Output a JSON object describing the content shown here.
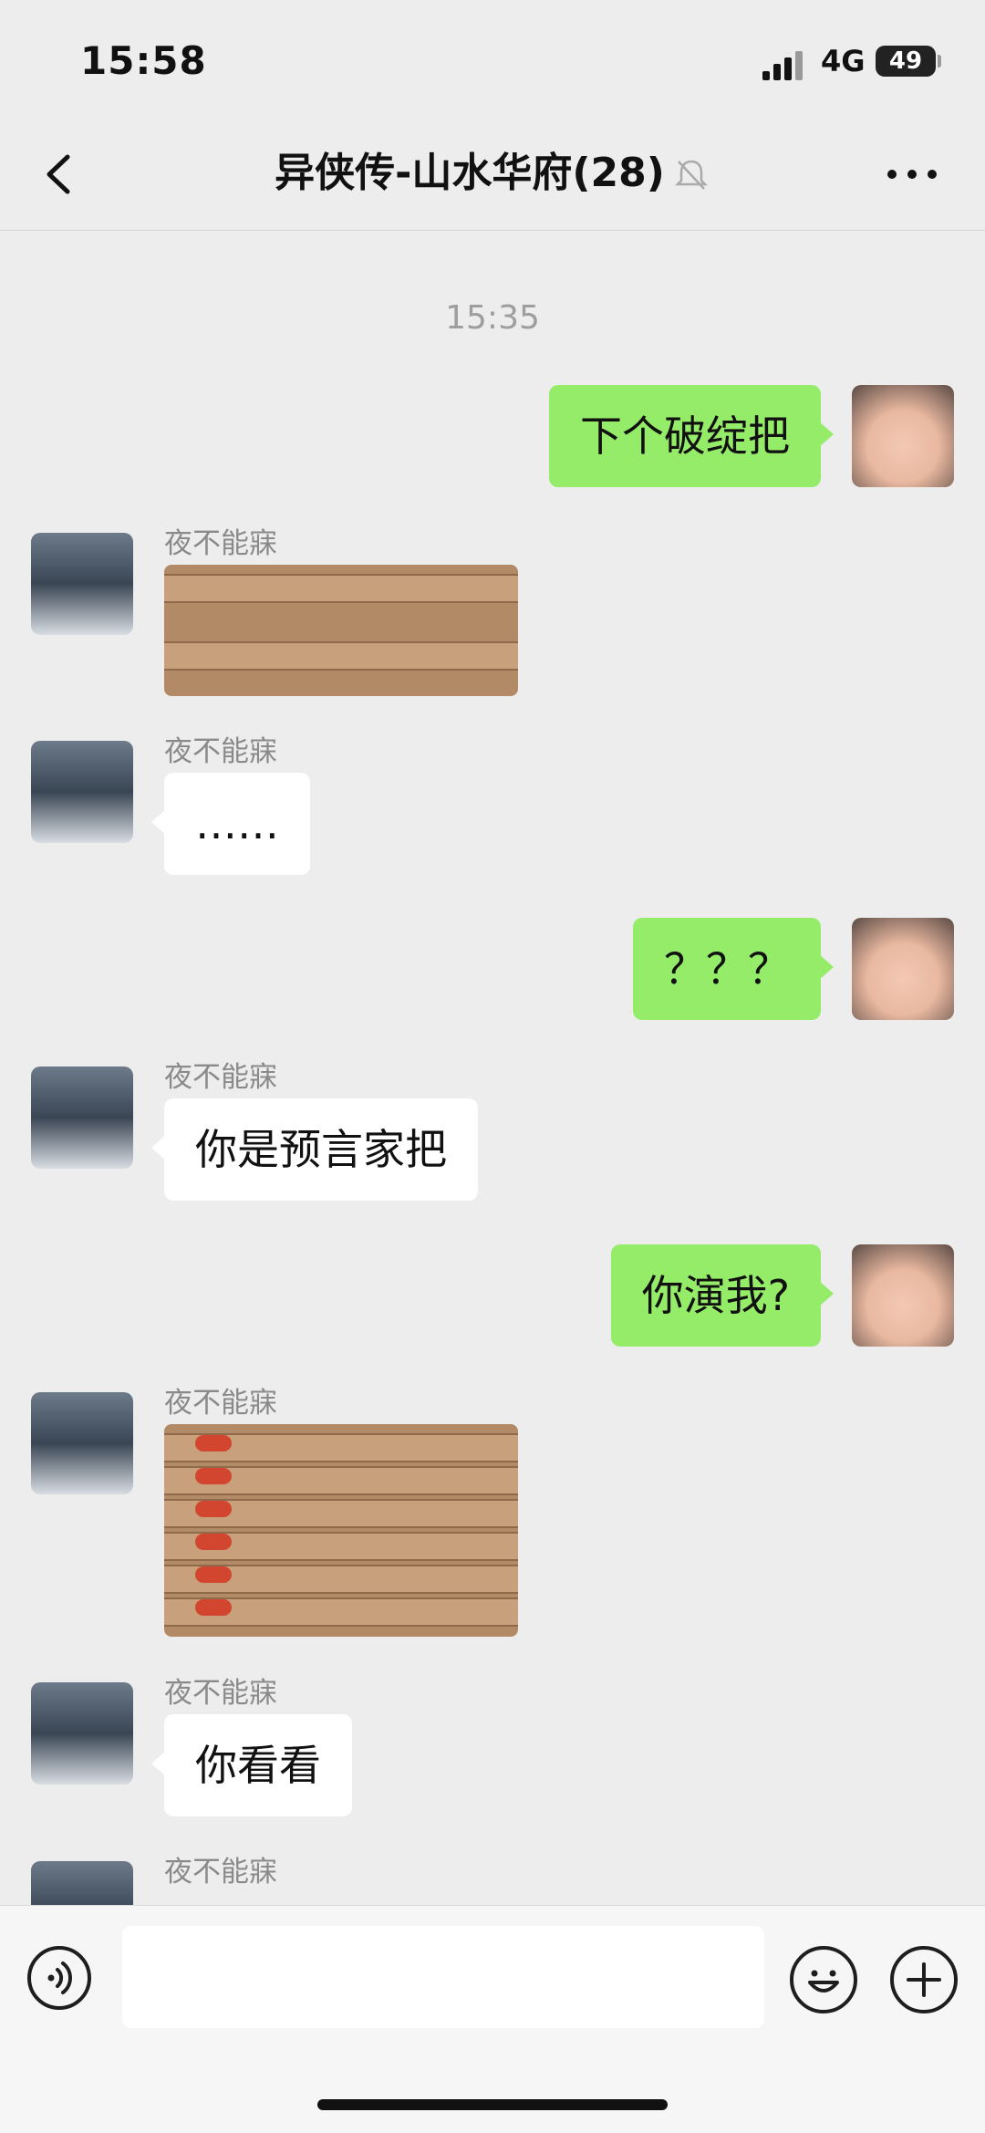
{
  "status_bar": {
    "time": "15:58",
    "network": "4G",
    "battery": "49"
  },
  "header": {
    "title": "异侠传-山水华府(28)"
  },
  "chat": {
    "timestamp": "15:35",
    "messages": [
      {
        "side": "right",
        "text": "下个破绽把"
      },
      {
        "side": "left",
        "sender": "夜不能寐",
        "type": "image"
      },
      {
        "side": "left",
        "sender": "夜不能寐",
        "text": "……"
      },
      {
        "side": "right",
        "text": "？？？"
      },
      {
        "side": "left",
        "sender": "夜不能寐",
        "text": "你是预言家把"
      },
      {
        "side": "right",
        "text": "你演我?"
      },
      {
        "side": "left",
        "sender": "夜不能寐",
        "type": "image"
      },
      {
        "side": "left",
        "sender": "夜不能寐",
        "text": "你看看"
      },
      {
        "side": "left",
        "sender": "夜不能寐",
        "type": "partial"
      }
    ]
  },
  "input": {
    "placeholder": ""
  },
  "colors": {
    "outgoing_bubble": "#95ec69",
    "incoming_bubble": "#ffffff",
    "background": "#ededed"
  }
}
